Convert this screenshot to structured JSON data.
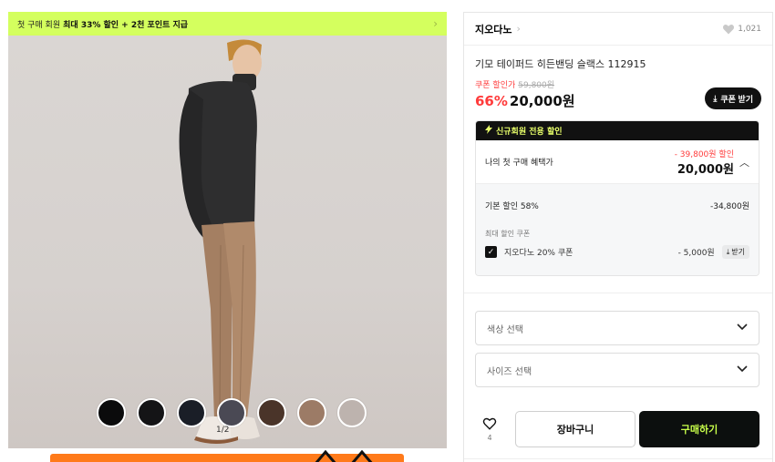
{
  "promo": {
    "lead": "첫 구매 회원",
    "highlight": "최대 33% 할인 + 2천 포인트 지급",
    "chevron_icon": "chevron-right-icon"
  },
  "gallery": {
    "pager": "1/2",
    "swatch_colors": [
      "#0b0b0c",
      "#141416",
      "#1a1e27",
      "#4a4954",
      "#4a3429",
      "#9c7b66",
      "#bdb3ae"
    ]
  },
  "product": {
    "brand": "지오다노",
    "brand_chevron": "›",
    "like_count": "1,021",
    "title": "기모 테이퍼드 히든밴딩 슬랙스 112915",
    "coupon_label": "쿠폰 할인가",
    "original_price": "59,800원",
    "discount_rate": "66%",
    "sale_price": "20,000원",
    "coupon_button": "쿠폰 받기"
  },
  "benefits": {
    "header": "신규회원 전용 할인",
    "first_purchase_label": "나의 첫 구매 혜택가",
    "first_purchase_discount": "- 39,800원 할인",
    "first_purchase_price": "20,000원",
    "base_discount_label": "기본 할인 58%",
    "base_discount_value": "-34,800원",
    "max_coupon_label": "최대 할인 쿠폰",
    "coupon_name": "지오다노 20% 쿠폰",
    "coupon_value": "- 5,000원",
    "coupon_get": "받기"
  },
  "options": {
    "color_placeholder": "색상 선택",
    "size_placeholder": "사이즈 선택"
  },
  "actions": {
    "wish_count": "4",
    "cart_label": "장바구니",
    "buy_label": "구매하기"
  },
  "colors": {
    "accent_lime": "#d4ff5e",
    "sale_red": "#ff3b3b",
    "buy_button_text": "#c8ff4a"
  }
}
